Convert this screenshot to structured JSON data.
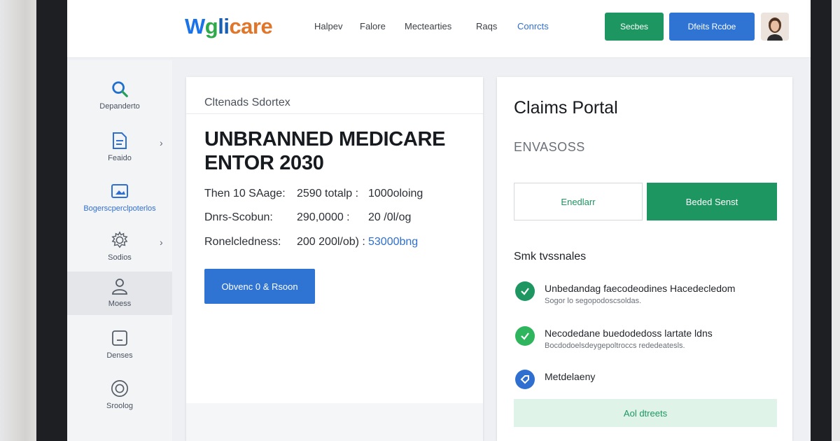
{
  "header": {
    "logo": {
      "w": "W",
      "g": "g",
      "mid": "li",
      "rest": "care"
    },
    "nav": [
      {
        "label": "Halpev"
      },
      {
        "label": "Falore"
      },
      {
        "label": "Mectearties"
      },
      {
        "label": "Raqs"
      },
      {
        "label": "Conrcts"
      }
    ],
    "green_button": "Secbes",
    "blue_button": "Dfeits Rcdoe"
  },
  "sidebar": {
    "items": [
      {
        "label": "Depanderto",
        "icon": "search-icon"
      },
      {
        "label": "Feaido",
        "icon": "document-icon"
      },
      {
        "label": "Bogerscperclpoterlos",
        "icon": "image-folder-icon"
      },
      {
        "label": "Sodios",
        "icon": "gear-icon"
      },
      {
        "label": "Moess",
        "icon": "person-icon"
      },
      {
        "label": "Denses",
        "icon": "minus-square-icon"
      },
      {
        "label": "Sroolog",
        "icon": "shield-icon"
      }
    ]
  },
  "main": {
    "header": "Cltenads Sdortex",
    "headline": "UNBRANNED MEDICARE ENTOR 2030",
    "rows": [
      {
        "a": "Then 10 SAage:",
        "b": "2590 totalp :",
        "c": "1000oloing"
      },
      {
        "a": "Dnrs-Scobun:",
        "b": "290,0000 :",
        "c": "20 /0l/og"
      },
      {
        "a": "Ronelcledness:",
        "b": "200 200l/ob) :",
        "c": "53000bng"
      }
    ],
    "cta": "Obvenc 0 & Rsoon"
  },
  "right": {
    "title": "Claims Portal",
    "subtitle": "ENVASOSS",
    "btn_outline": "Enedlarr",
    "btn_green": "Beded Senst",
    "section": "Smk tvssnales",
    "statuses": [
      {
        "line1": "Unbedandag faecodeodines Hacedecledom",
        "line2": "Sogor lo segopodoscsoldas."
      },
      {
        "line1": "Necodedane buedodedoss lartate ldns",
        "line2": "Bocdodoelsdeygepoltroccs rededeatesls."
      },
      {
        "line1": "Metdelaeny",
        "line2": ""
      }
    ],
    "footer_button": "Aol dtreets"
  },
  "colors": {
    "brand_green": "#1e9661",
    "brand_blue": "#2f73d3",
    "status_blue": "#2f6fd0"
  }
}
